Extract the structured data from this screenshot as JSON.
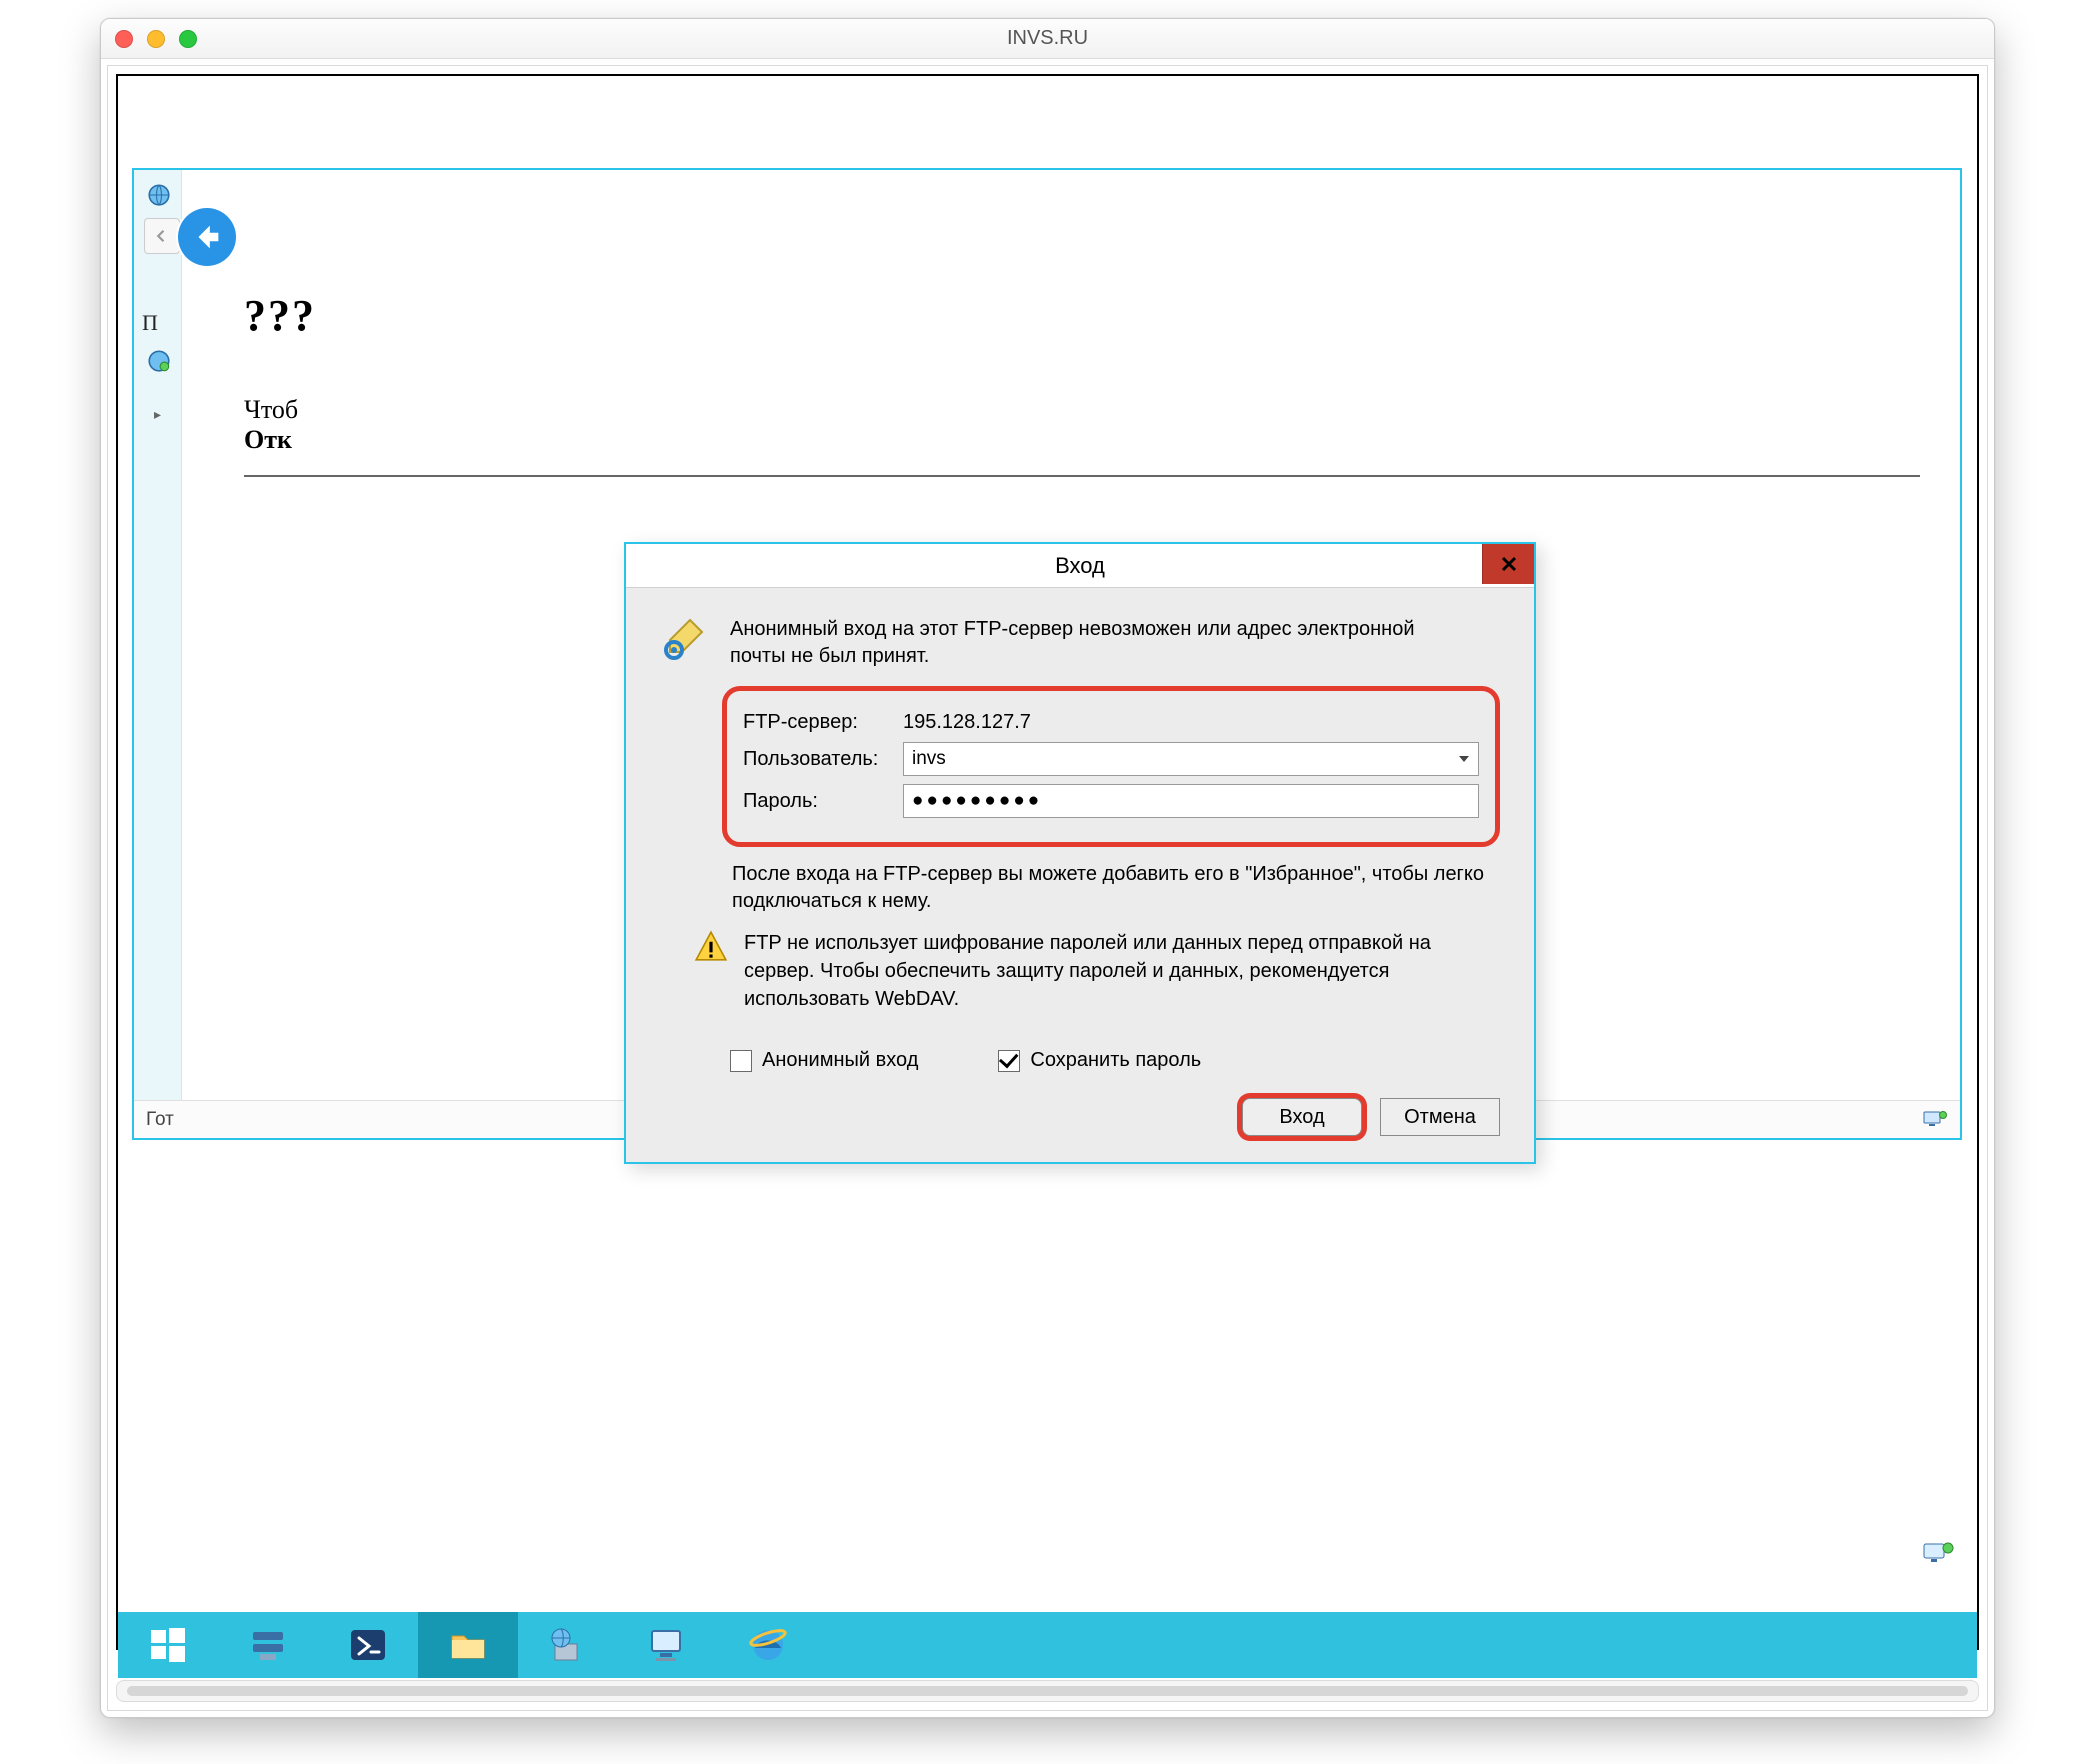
{
  "window": {
    "title": "INVS.RU"
  },
  "background": {
    "heading": "???",
    "line1_partial": "Чтоб",
    "line2_partial": "Отк",
    "toolbar_left_partial": "П",
    "statusbar_left": "Гот"
  },
  "dialog": {
    "title": "Вход",
    "intro": "Анонимный вход на этот FTP-сервер невозможен или адрес электронной почты не был принят.",
    "server": {
      "label": "FTP-сервер:",
      "value": "195.128.127.7"
    },
    "user": {
      "label": "Пользователь:",
      "value": "invs"
    },
    "password": {
      "label": "Пароль:",
      "value_masked": "●●●●●●●●●"
    },
    "note": "После входа на FTP-сервер вы можете добавить его в \"Избранное\", чтобы легко подключаться к нему.",
    "warning": "FTP не использует шифрование паролей или данных перед отправкой на сервер. Чтобы обеспечить защиту паролей и данных, рекомендуется использовать WebDAV.",
    "checkbox_anonymous": {
      "label": "Анонимный вход",
      "checked": false
    },
    "checkbox_save": {
      "label": "Сохранить пароль",
      "checked": true
    },
    "buttons": {
      "login": "Вход",
      "cancel": "Отмена"
    }
  },
  "taskbar": {
    "items": [
      {
        "name": "start",
        "label": "Start"
      },
      {
        "name": "server-manager",
        "label": "Server Manager"
      },
      {
        "name": "powershell",
        "label": "PowerShell"
      },
      {
        "name": "file-explorer",
        "label": "File Explorer"
      },
      {
        "name": "iis",
        "label": "IIS Manager"
      },
      {
        "name": "system",
        "label": "System"
      },
      {
        "name": "internet-explorer",
        "label": "Internet Explorer"
      }
    ]
  },
  "colors": {
    "accent_cyan": "#2fc1de",
    "border_cyan": "#29c4e8",
    "highlight_red": "#e33b2e",
    "close_red": "#c0392b",
    "blue_back": "#2994e6"
  }
}
